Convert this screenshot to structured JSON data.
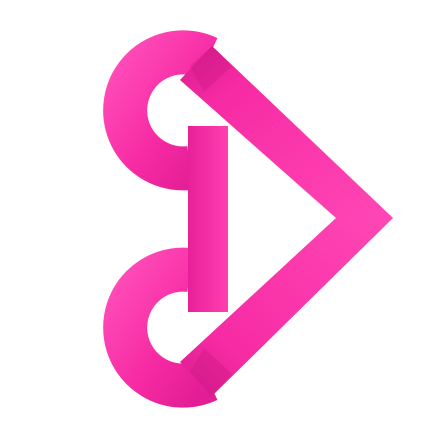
{
  "logo": {
    "icon": "heart-play-logo-icon",
    "colors": {
      "primary": "#f72ba4",
      "light": "#ff4bb8",
      "shadow": "#c71680",
      "background": "#ffffff"
    }
  }
}
